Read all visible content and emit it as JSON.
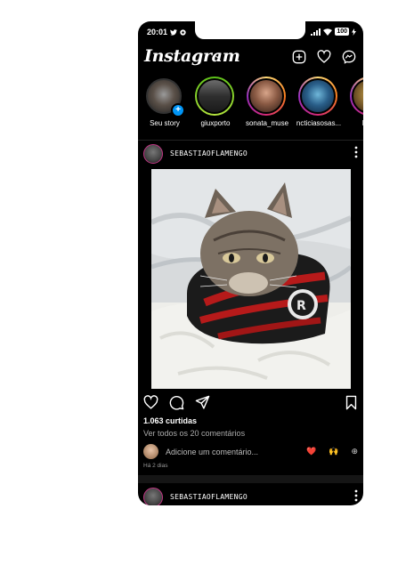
{
  "status": {
    "time": "20:01",
    "battery": "100"
  },
  "header": {
    "logo": "Instagram",
    "chevron": "⌄"
  },
  "stories": [
    {
      "label": "Seu story",
      "own": true
    },
    {
      "label": "giuxporto"
    },
    {
      "label": "sonata_muse"
    },
    {
      "label": "ncticiasosas..."
    },
    {
      "label": "bro..."
    }
  ],
  "post": {
    "username": "SEBASTIAOFLAMENGO",
    "likes": "1.063 curtidas",
    "comments_link": "Ver todos os 20 comentários",
    "add_comment_placeholder": "Adicione um comentário...",
    "reactions": [
      "❤️",
      "🙌",
      "⊕"
    ],
    "time_ago": "Há 2 dias"
  },
  "next_post": {
    "username": "SEBASTIAOFLAMENGO"
  },
  "colors": {
    "story_ring": "#e1306c",
    "accent_blue": "#0095f6",
    "background": "#000000"
  }
}
